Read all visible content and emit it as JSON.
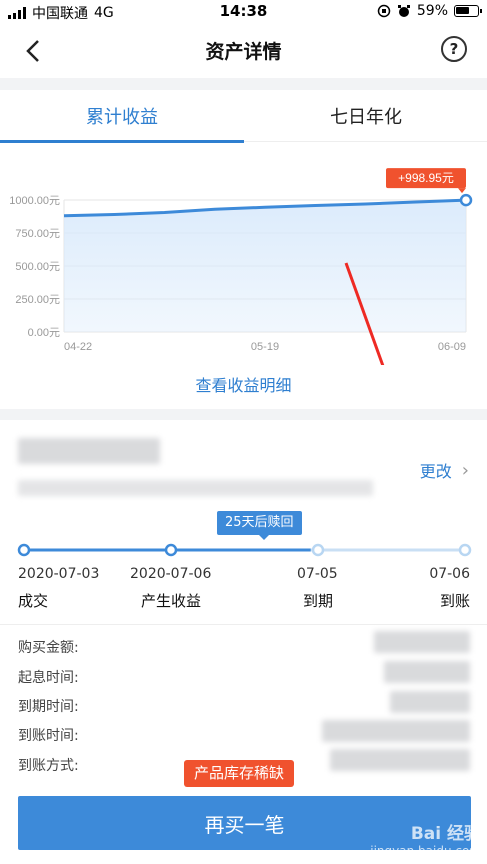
{
  "status_bar": {
    "carrier": "中国联通",
    "network": "4G",
    "time": "14:38",
    "battery": "59%"
  },
  "nav": {
    "title": "资产详情",
    "help": "?"
  },
  "tabs": [
    {
      "label": "累计收益",
      "active": true
    },
    {
      "label": "七日年化",
      "active": false
    }
  ],
  "chart_data": {
    "type": "area",
    "x": [
      "04-22",
      "05-19",
      "06-09"
    ],
    "y_tick_labels": [
      "1000.00元",
      "750.00元",
      "500.00元",
      "250.00元",
      "0.00元"
    ],
    "ylim": [
      0,
      1000
    ],
    "series": [
      {
        "values": [
          880,
          890,
          905,
          930,
          945,
          958,
          970,
          985,
          998.95
        ]
      }
    ],
    "end_label": "+998.95元",
    "grid": true,
    "line_color": "#3d8ad9",
    "fill_color": "#d8e9fb"
  },
  "chart_link": "查看收益明细",
  "order": {
    "change_label": "更改",
    "change_chevron": "›"
  },
  "timeline": {
    "badge": "25天后赎回",
    "steps": [
      {
        "date": "2020-07-03",
        "label": "成交",
        "done": true
      },
      {
        "date": "2020-07-06",
        "label": "产生收益",
        "done": true
      },
      {
        "date": "07-05",
        "label": "到期",
        "done": false
      },
      {
        "date": "07-06",
        "label": "到账",
        "done": false
      }
    ],
    "progress": 0.65
  },
  "info": {
    "labels": [
      "购买金额:",
      "起息时间:",
      "到期时间:",
      "到账时间:",
      "到账方式:"
    ]
  },
  "footer": {
    "scarcity_badge": "产品库存稀缺",
    "buy_button": "再买一笔"
  },
  "watermark": {
    "brand": "Bai 经验",
    "url": "jingyan.baidu.com"
  },
  "colors": {
    "accent": "#2f7fd0",
    "primary_button": "#3d8ad9",
    "alert": "#f0522e"
  }
}
